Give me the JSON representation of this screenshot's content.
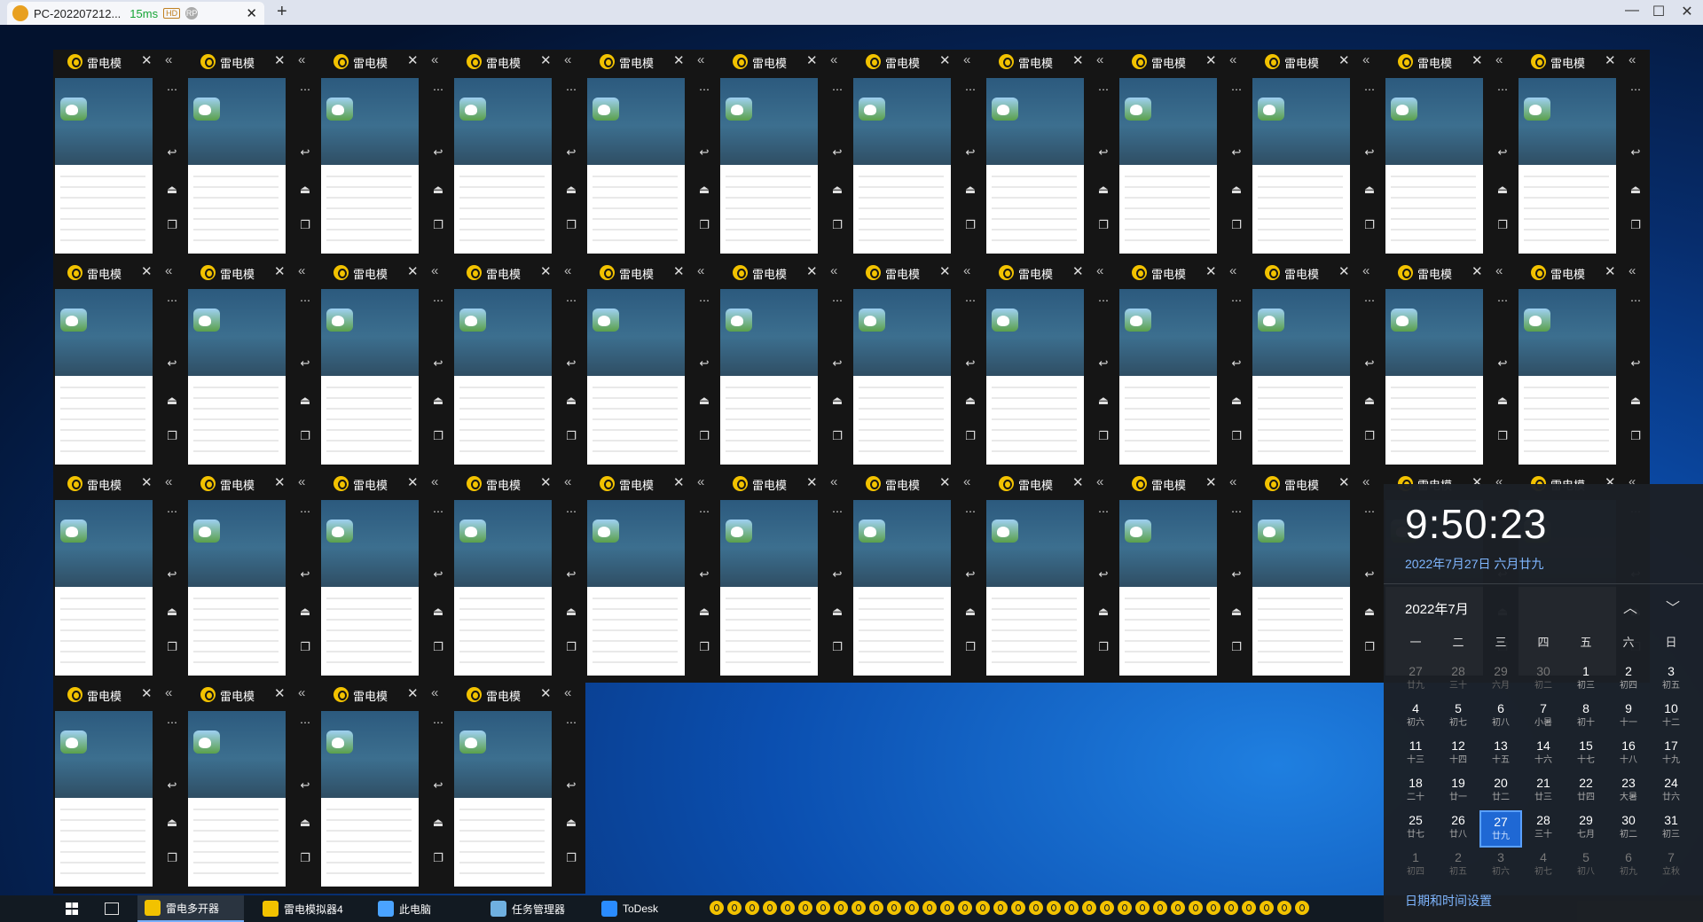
{
  "titlebar": {
    "tab_title": "PC-202207212...",
    "ping": "15ms",
    "badge_hd": "HD",
    "badge_rp": "RP",
    "tab_close": "✕",
    "new_tab": "+",
    "minimize": "—",
    "maximize": "☐",
    "close": "✕"
  },
  "emulator": {
    "title": "雷电模",
    "close_glyph": "✕",
    "collapse_glyph": "«",
    "menu_glyph": "⋯",
    "back_glyph": "↩",
    "home_glyph": "⏏",
    "recent_glyph": "❐",
    "rows": [
      12,
      12,
      12,
      4
    ]
  },
  "clock": {
    "time": "9:50:23",
    "date": "2022年7月27日 六月廿九",
    "month_label": "2022年7月",
    "up": "︿",
    "down": "﹀",
    "weekdays": [
      "一",
      "二",
      "三",
      "四",
      "五",
      "六",
      "日"
    ],
    "days": [
      {
        "d": "27",
        "l": "廿九",
        "dim": true
      },
      {
        "d": "28",
        "l": "三十",
        "dim": true
      },
      {
        "d": "29",
        "l": "六月",
        "dim": true
      },
      {
        "d": "30",
        "l": "初二",
        "dim": true
      },
      {
        "d": "1",
        "l": "初三"
      },
      {
        "d": "2",
        "l": "初四"
      },
      {
        "d": "3",
        "l": "初五"
      },
      {
        "d": "4",
        "l": "初六"
      },
      {
        "d": "5",
        "l": "初七"
      },
      {
        "d": "6",
        "l": "初八"
      },
      {
        "d": "7",
        "l": "小暑"
      },
      {
        "d": "8",
        "l": "初十"
      },
      {
        "d": "9",
        "l": "十一"
      },
      {
        "d": "10",
        "l": "十二"
      },
      {
        "d": "11",
        "l": "十三"
      },
      {
        "d": "12",
        "l": "十四"
      },
      {
        "d": "13",
        "l": "十五"
      },
      {
        "d": "14",
        "l": "十六"
      },
      {
        "d": "15",
        "l": "十七"
      },
      {
        "d": "16",
        "l": "十八"
      },
      {
        "d": "17",
        "l": "十九"
      },
      {
        "d": "18",
        "l": "二十"
      },
      {
        "d": "19",
        "l": "廿一"
      },
      {
        "d": "20",
        "l": "廿二"
      },
      {
        "d": "21",
        "l": "廿三"
      },
      {
        "d": "22",
        "l": "廿四"
      },
      {
        "d": "23",
        "l": "大暑"
      },
      {
        "d": "24",
        "l": "廿六"
      },
      {
        "d": "25",
        "l": "廿七"
      },
      {
        "d": "26",
        "l": "廿八"
      },
      {
        "d": "27",
        "l": "廿九",
        "today": true
      },
      {
        "d": "28",
        "l": "三十"
      },
      {
        "d": "29",
        "l": "七月"
      },
      {
        "d": "30",
        "l": "初二"
      },
      {
        "d": "31",
        "l": "初三"
      },
      {
        "d": "1",
        "l": "初四",
        "dim": true
      },
      {
        "d": "2",
        "l": "初五",
        "dim": true
      },
      {
        "d": "3",
        "l": "初六",
        "dim": true
      },
      {
        "d": "4",
        "l": "初七",
        "dim": true
      },
      {
        "d": "5",
        "l": "初八",
        "dim": true
      },
      {
        "d": "6",
        "l": "初九",
        "dim": true
      },
      {
        "d": "7",
        "l": "立秋",
        "dim": true
      }
    ],
    "settings_link": "日期和时间设置"
  },
  "taskbar": {
    "items": [
      {
        "label": "雷电多开器",
        "color": "#f2c200",
        "active": true
      },
      {
        "label": "雷电模拟器4",
        "color": "#f2c200",
        "active": false
      },
      {
        "label": "此电脑",
        "color": "#4aa3ff",
        "active": false
      },
      {
        "label": "任务管理器",
        "color": "#6fb0e0",
        "active": false
      },
      {
        "label": "ToDesk",
        "color": "#2a8cff",
        "active": false
      }
    ],
    "tray_count": 34
  },
  "colors": {
    "accent": "#1f68d4",
    "link": "#7fb6ff",
    "emulator_logo": "#f2c200"
  }
}
